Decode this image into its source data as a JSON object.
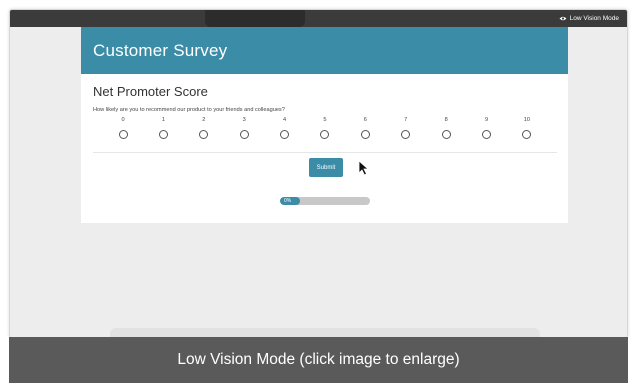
{
  "app": {
    "low_vision_label": "Low Vision Mode",
    "icon": "eye-icon"
  },
  "survey": {
    "title": "Customer Survey",
    "question_title": "Net Promoter Score",
    "question_text": "How likely are you to recommend our product to your friends and colleagues?",
    "scale_options": [
      "0",
      "1",
      "2",
      "3",
      "4",
      "5",
      "6",
      "7",
      "8",
      "9",
      "10"
    ],
    "selected": null,
    "submit_label": "Submit",
    "progress": {
      "label": "0%",
      "value": 0
    }
  },
  "caption": "Low Vision Mode (click image to enlarge)",
  "colors": {
    "accent": "#3a8ca7",
    "topbar": "#3b3b3b",
    "caption_bg": "#5a5a5a",
    "page_bg": "#ededed"
  }
}
